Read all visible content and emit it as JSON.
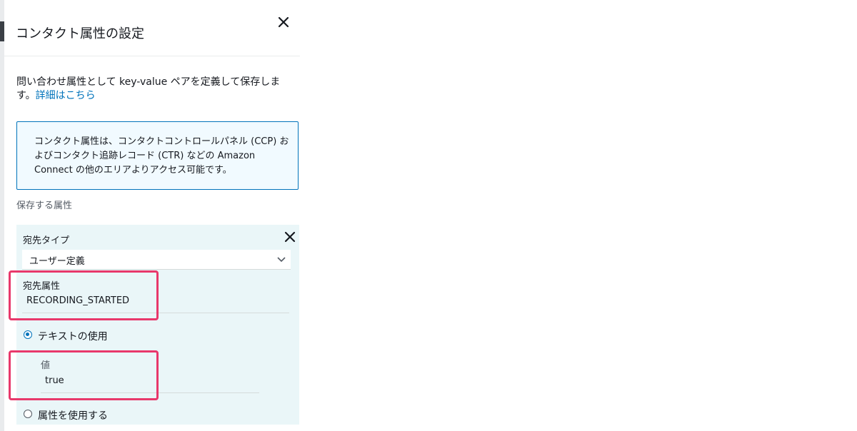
{
  "panel": {
    "title": "コンタクト属性の設定",
    "description": "問い合わせ属性として key-value ペアを定義して保存します。",
    "learn_more_link": "詳細はこちら",
    "info_text": "コンタクト属性は、コンタクトコントロールパネル (CCP) およびコンタクト追跡レコード (CTR) などの Amazon Connect の他のエリアよりアクセス可能です。",
    "section_label": "保存する属性"
  },
  "attribute": {
    "destination_type_label": "宛先タイプ",
    "destination_type_value": "ユーザー定義",
    "destination_attr_label": "宛先属性",
    "destination_attr_value": "RECORDING_STARTED",
    "option_text": "テキストの使用",
    "option_text_selected": true,
    "value_label": "値",
    "value_value": "true",
    "option_attribute": "属性を使用する"
  },
  "colors": {
    "accent": "#0073bb",
    "highlight": "#e8386b",
    "card_bg": "#eaf6f8",
    "info_bg": "#f1faff"
  },
  "icons": {
    "close": "close-icon",
    "remove": "close-icon",
    "dropdown": "chevron-down-icon"
  }
}
